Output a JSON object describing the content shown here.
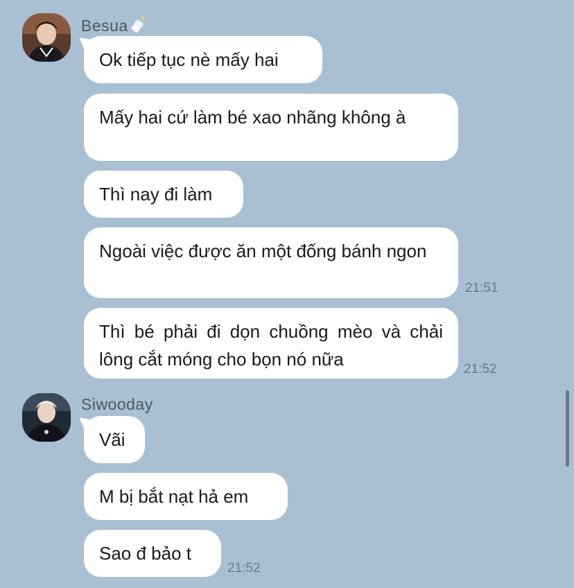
{
  "colors": {
    "background": "#a9bfd2",
    "bubble": "#ffffff",
    "sender_text": "#4d5866",
    "time_text": "#6b7a8a"
  },
  "groups": [
    {
      "sender": "Besua",
      "sender_emoji_icon": "baby-bottle-icon",
      "messages": [
        {
          "text": "Ok tiếp tục nè mấy hai",
          "time": ""
        },
        {
          "text": "Mấy hai cứ làm bé xao nhãng không à",
          "time": ""
        },
        {
          "text": "Thì nay đi làm",
          "time": ""
        },
        {
          "text": "Ngoài việc được ăn một đống bánh ngon",
          "time": "21:51"
        },
        {
          "text": "Thì bé phải đi dọn chuồng mèo và chải lông cắt móng cho bọn nó nữa",
          "time": "21:52"
        }
      ]
    },
    {
      "sender": "Siwooday",
      "messages": [
        {
          "text": "Vãi",
          "time": ""
        },
        {
          "text": "M bị bắt nạt hả em",
          "time": ""
        },
        {
          "text": "Sao đ bảo t",
          "time": "21:52"
        }
      ]
    }
  ]
}
